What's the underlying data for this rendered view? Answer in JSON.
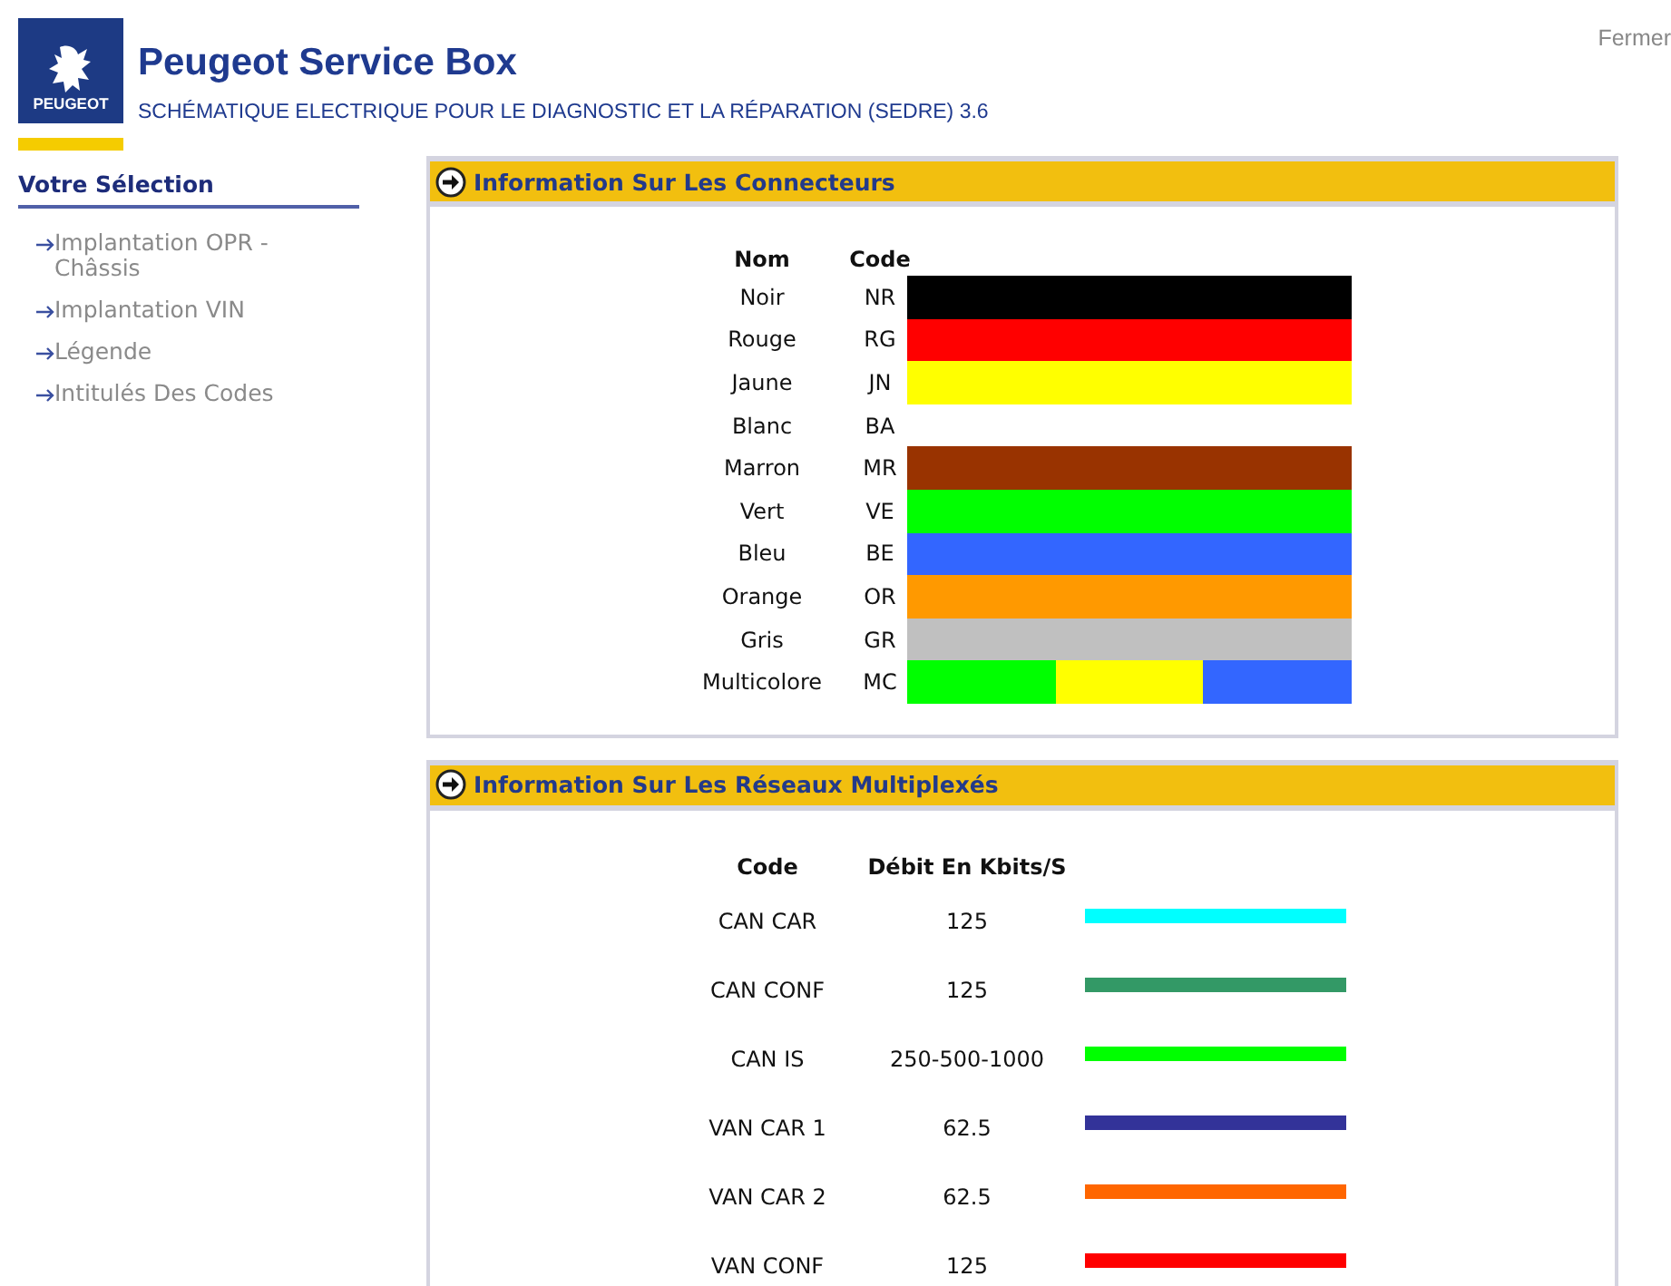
{
  "header": {
    "logo_text": "PEUGEOT",
    "title": "Peugeot Service Box",
    "subtitle": "SCHÉMATIQUE ELECTRIQUE POUR LE DIAGNOSTIC ET LA RÉPARATION (SEDRE) 3.6",
    "close_link": "Fermer"
  },
  "sidebar": {
    "title": "Votre Sélection",
    "items": [
      {
        "label": "Implantation OPR - Châssis"
      },
      {
        "label": "Implantation VIN"
      },
      {
        "label": "Légende"
      },
      {
        "label": "Intitulés Des Codes"
      }
    ]
  },
  "connectors": {
    "title": "Information Sur Les Connecteurs",
    "columns": [
      "Nom",
      "Code"
    ],
    "rows": [
      {
        "name": "Noir",
        "code": "NR",
        "segments": [
          {
            "color": "#000000"
          }
        ]
      },
      {
        "name": "Rouge",
        "code": "RG",
        "segments": [
          {
            "color": "#ff0000"
          }
        ]
      },
      {
        "name": "Jaune",
        "code": "JN",
        "segments": [
          {
            "color": "#ffff00"
          }
        ]
      },
      {
        "name": "Blanc",
        "code": "BA",
        "segments": [
          {
            "color": "#ffffff"
          }
        ]
      },
      {
        "name": "Marron",
        "code": "MR",
        "segments": [
          {
            "color": "#993300"
          }
        ]
      },
      {
        "name": "Vert",
        "code": "VE",
        "segments": [
          {
            "color": "#00ff00"
          }
        ]
      },
      {
        "name": "Bleu",
        "code": "BE",
        "segments": [
          {
            "color": "#3366ff"
          }
        ]
      },
      {
        "name": "Orange",
        "code": "OR",
        "segments": [
          {
            "color": "#ff9900"
          }
        ]
      },
      {
        "name": "Gris",
        "code": "GR",
        "segments": [
          {
            "color": "#c0c0c0"
          }
        ]
      },
      {
        "name": "Multicolore",
        "code": "MC",
        "segments": [
          {
            "color": "#00ff00"
          },
          {
            "color": "#ffff00"
          },
          {
            "color": "#3366ff"
          }
        ]
      }
    ]
  },
  "networks": {
    "title": "Information Sur Les Réseaux Multiplexés",
    "columns": [
      "Code",
      "Débit En Kbits/S"
    ],
    "rows": [
      {
        "code": "CAN CAR",
        "rate": "125",
        "color": "#00ffff"
      },
      {
        "code": "CAN CONF",
        "rate": "125",
        "color": "#339966"
      },
      {
        "code": "CAN IS",
        "rate": "250-500-1000",
        "color": "#00ff00"
      },
      {
        "code": "VAN CAR 1",
        "rate": "62.5",
        "color": "#333399"
      },
      {
        "code": "VAN CAR 2",
        "rate": "62.5",
        "color": "#ff6600"
      },
      {
        "code": "VAN CONF",
        "rate": "125",
        "color": "#ff0000"
      }
    ]
  }
}
